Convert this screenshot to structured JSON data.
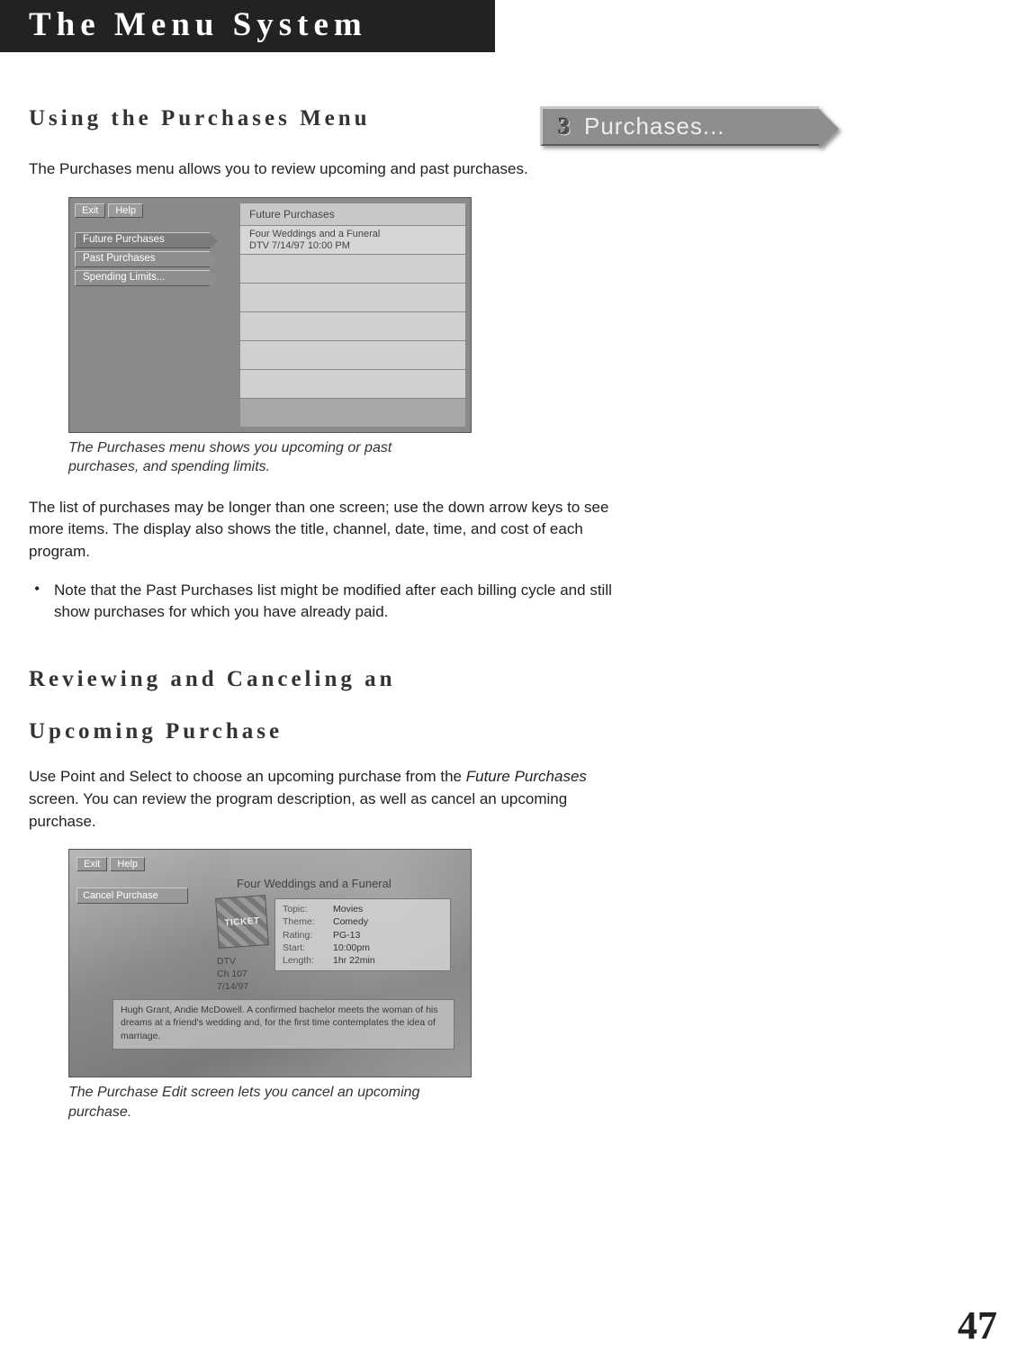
{
  "title_bar": "The Menu System",
  "section1": {
    "heading": "Using the Purchases Menu",
    "intro": "The Purchases menu allows you to review upcoming and past purchases.",
    "caption": "The Purchases menu shows you upcoming or past purchases, and spending limits.",
    "para2": "The list of purchases may be longer than one screen; use the down arrow keys to see more items. The display also shows the title, channel, date, time, and cost of each program.",
    "bullet1": "Note that the Past Purchases list might be modified after each billing cycle and still show purchases for which you have already paid."
  },
  "tag": {
    "num": "3",
    "label": "Purchases..."
  },
  "screen1": {
    "exit": "Exit",
    "help": "Help",
    "side": [
      "Future Purchases",
      "Past Purchases",
      "Spending Limits..."
    ],
    "panel_header": "Future Purchases",
    "row1_line1": "Four Weddings and a Funeral",
    "row1_line2": "DTV  7/14/97  10:00 PM"
  },
  "section2": {
    "heading_line1": "Reviewing and Canceling an",
    "heading_line2": "Upcoming Purchase",
    "intro_pre": "Use Point and Select to choose an upcoming purchase from the ",
    "intro_em": "Future Purchases",
    "intro_post": " screen. You can review the program description, as well as cancel an upcoming purchase.",
    "caption": "The Purchase Edit screen lets you cancel an upcoming purchase."
  },
  "screen2": {
    "exit": "Exit",
    "help": "Help",
    "cancel": "Cancel Purchase",
    "movie_title": "Four Weddings and a Funeral",
    "ticket": "TICKET",
    "meta": {
      "topic_k": "Topic:",
      "topic_v": "Movies",
      "theme_k": "Theme:",
      "theme_v": "Comedy",
      "rating_k": "Rating:",
      "rating_v": "PG-13",
      "start_k": "Start:",
      "start_v": "10:00pm",
      "length_k": "Length:",
      "length_v": "1hr 22min"
    },
    "ch_line1": "DTV",
    "ch_line2": "Ch 107",
    "ch_line3": "7/14/97",
    "desc": "Hugh Grant, Andie McDowell. A confirmed bachelor meets the woman of his dreams at a friend's wedding and, for the first time contemplates the idea of marriage."
  },
  "page_number": "47"
}
